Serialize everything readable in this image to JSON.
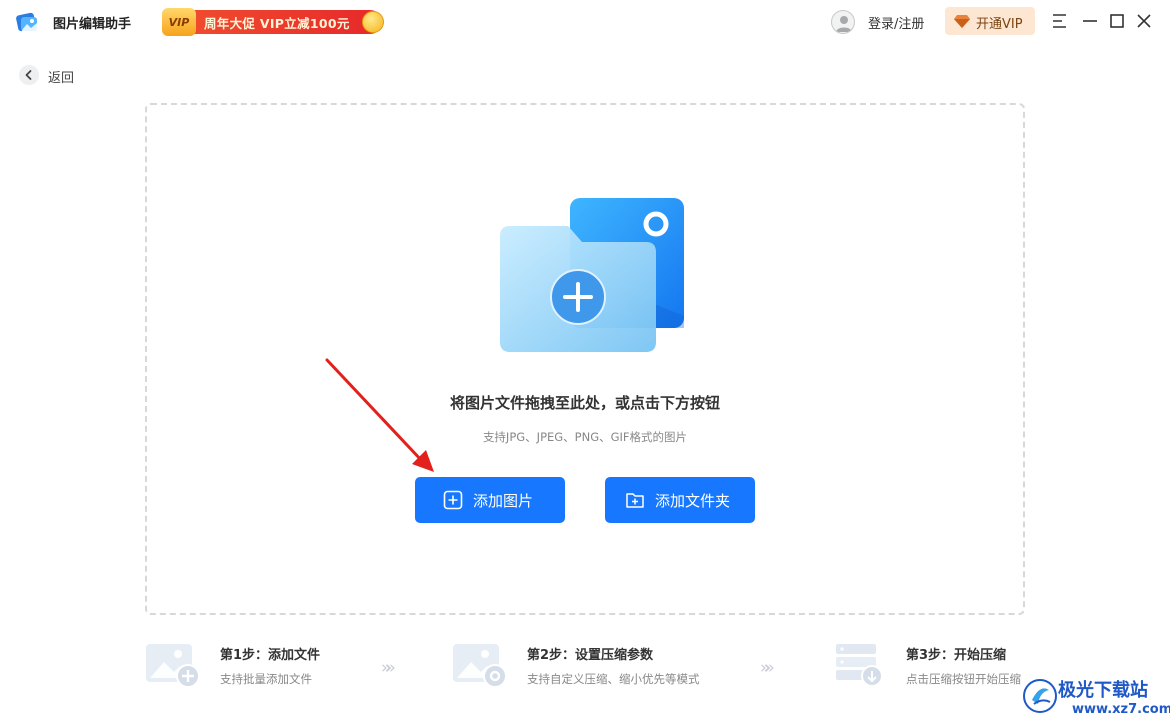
{
  "app": {
    "title": "图片编辑助手"
  },
  "promo": {
    "badge": "VIP",
    "text": "周年大促 VIP立减100元"
  },
  "header": {
    "login_label": "登录/注册",
    "vip_label": "开通VIP"
  },
  "nav": {
    "back_label": "返回"
  },
  "dropzone": {
    "title": "将图片文件拖拽至此处，或点击下方按钮",
    "subtitle": "支持JPG、JPEG、PNG、GIF格式的图片",
    "add_images_label": "添加图片",
    "add_folder_label": "添加文件夹"
  },
  "steps": [
    {
      "title": "第1步：添加文件",
      "desc": "支持批量添加文件"
    },
    {
      "title": "第2步：设置压缩参数",
      "desc": "支持自定义压缩、缩小优先等模式"
    },
    {
      "title": "第3步：开始压缩",
      "desc": "点击压缩按钮开始压缩"
    }
  ],
  "watermark": {
    "name": "极光下载站",
    "url": "www.xz7.com"
  },
  "colors": {
    "primary": "#1778ff",
    "promo": "#e7282a",
    "vip_bg": "#fde7d2",
    "annotation_arrow": "#e3211c"
  }
}
